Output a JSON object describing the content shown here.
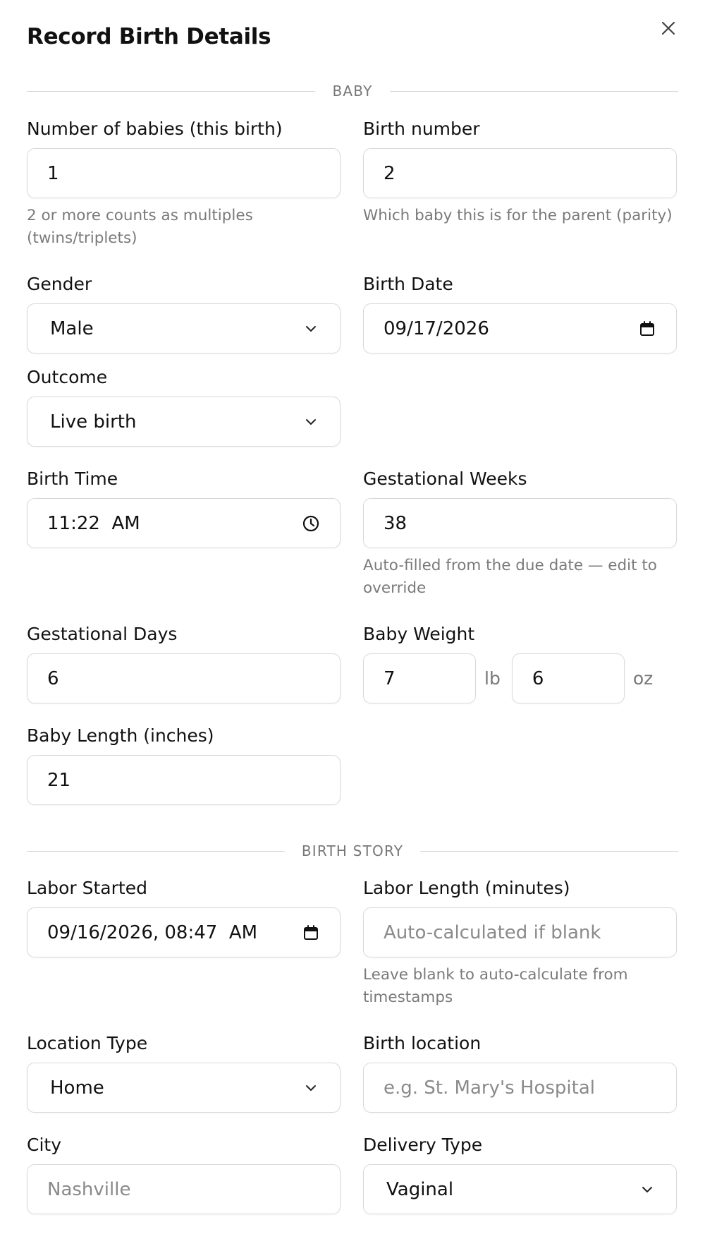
{
  "title": "Record Birth Details",
  "close_icon": "close-icon",
  "sections": {
    "baby": "BABY",
    "birth_story": "BIRTH STORY"
  },
  "fields": {
    "num_babies": {
      "label": "Number of babies (this birth)",
      "value": "1",
      "help": "2 or more counts as multiples (twins/triplets)"
    },
    "birth_number": {
      "label": "Birth number",
      "value": "2",
      "help": "Which baby this is for the parent (parity)"
    },
    "gender": {
      "label": "Gender",
      "value": "Male",
      "icon": "chevron-down-icon"
    },
    "birth_date": {
      "label": "Birth Date",
      "value": "09/17/2026",
      "icon": "calendar-icon"
    },
    "outcome": {
      "label": "Outcome",
      "value": "Live birth",
      "icon": "chevron-down-icon"
    },
    "birth_time": {
      "label": "Birth Time",
      "value": "11:22  AM",
      "icon": "clock-icon"
    },
    "gest_weeks": {
      "label": "Gestational Weeks",
      "value": "38",
      "help": "Auto-filled from the due date — edit to override"
    },
    "gest_days": {
      "label": "Gestational Days",
      "value": "6"
    },
    "baby_weight": {
      "label": "Baby Weight",
      "lb_value": "7",
      "lb_unit": "lb",
      "oz_value": "6",
      "oz_unit": "oz"
    },
    "baby_length": {
      "label": "Baby Length (inches)",
      "value": "21"
    },
    "labor_started": {
      "label": "Labor Started",
      "value": "09/16/2026, 08:47  AM",
      "icon": "calendar-icon"
    },
    "labor_length": {
      "label": "Labor Length (minutes)",
      "placeholder": "Auto-calculated if blank",
      "help": "Leave blank to auto-calculate from timestamps"
    },
    "location_type": {
      "label": "Location Type",
      "value": "Home",
      "icon": "chevron-down-icon"
    },
    "birth_location": {
      "label": "Birth location",
      "placeholder": "e.g. St. Mary's Hospital"
    },
    "city": {
      "label": "City",
      "placeholder": "Nashville"
    },
    "delivery_type": {
      "label": "Delivery Type",
      "value": "Vaginal",
      "icon": "chevron-down-icon"
    }
  }
}
